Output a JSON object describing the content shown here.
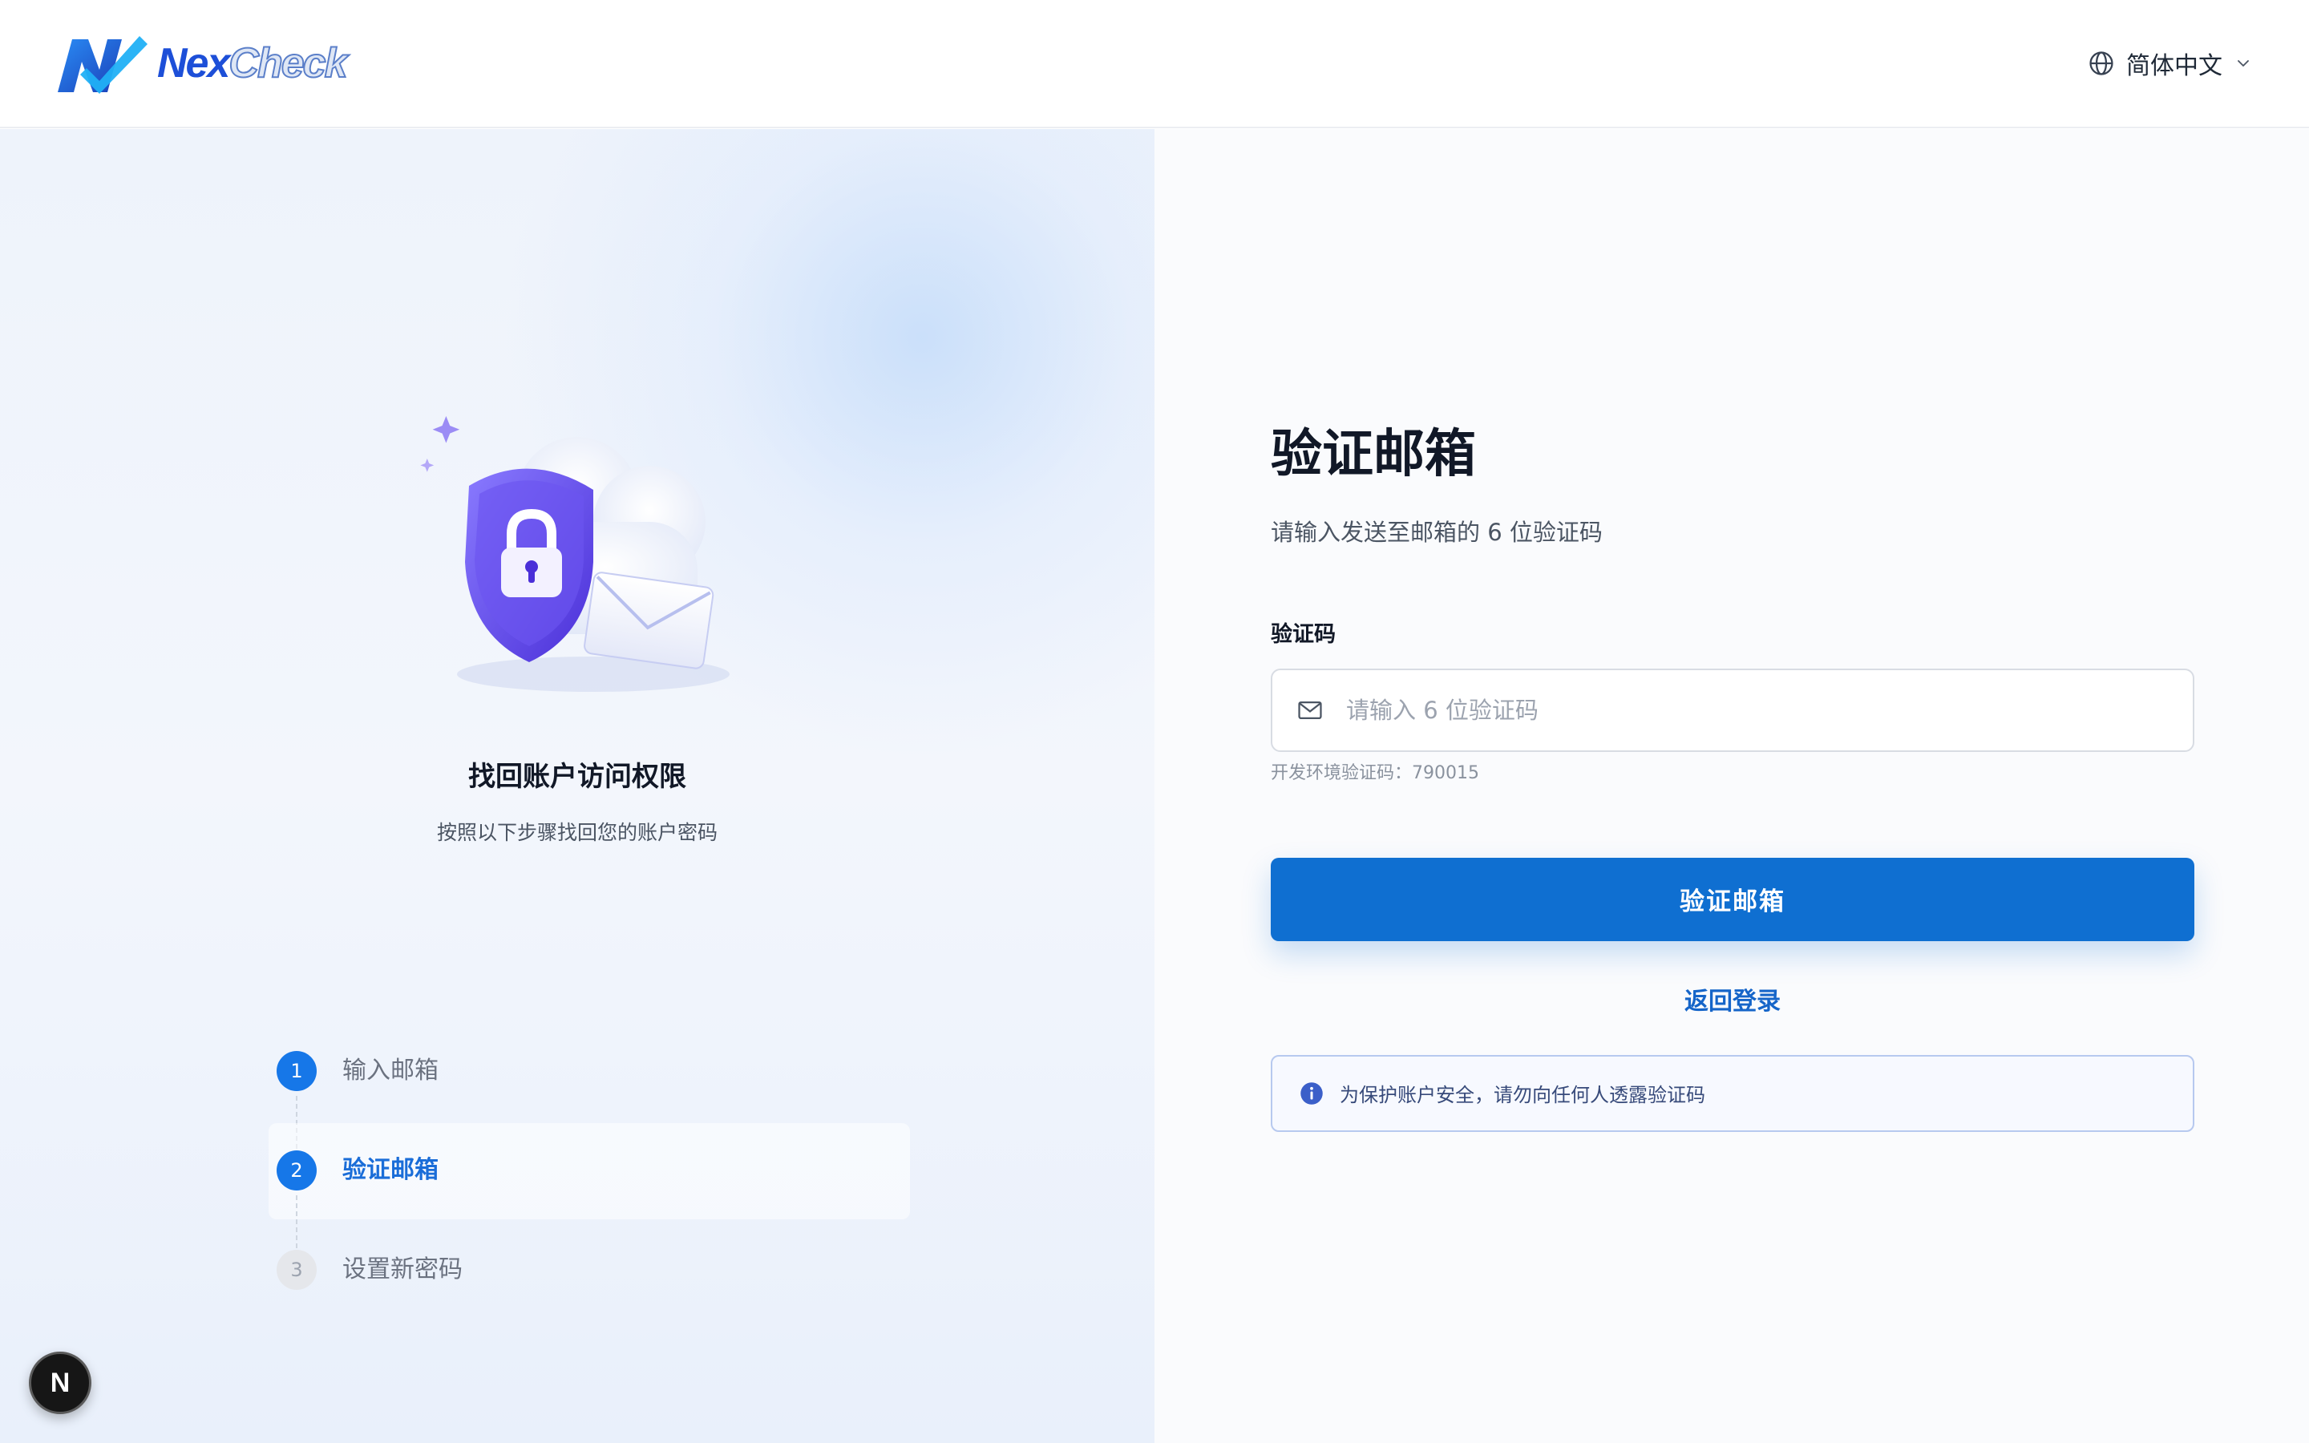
{
  "header": {
    "logo": {
      "part1": "Nex",
      "part2": "Check"
    },
    "language": {
      "icon": "globe-icon",
      "label": "简体中文",
      "chevron": "chevron-down-icon"
    }
  },
  "left": {
    "title": "找回账户访问权限",
    "subtitle": "按照以下步骤找回您的账户密码",
    "steps": [
      {
        "number": "1",
        "label": "输入邮箱",
        "state": "completed"
      },
      {
        "number": "2",
        "label": "验证邮箱",
        "state": "active"
      },
      {
        "number": "3",
        "label": "设置新密码",
        "state": "pending"
      }
    ]
  },
  "form": {
    "title": "验证邮箱",
    "subtitle": "请输入发送至邮箱的 6 位验证码",
    "code_label": "验证码",
    "code_placeholder": "请输入 6 位验证码",
    "code_value": "",
    "dev_hint": "开发环境验证码：790015",
    "submit_label": "验证邮箱",
    "back_label": "返回登录",
    "notice": "为保护账户安全，请勿向任何人透露验证码"
  },
  "badge": {
    "letter": "N"
  },
  "colors": {
    "primary": "#0f6fd1",
    "step_active": "#1677e8",
    "link": "#1565c9"
  }
}
